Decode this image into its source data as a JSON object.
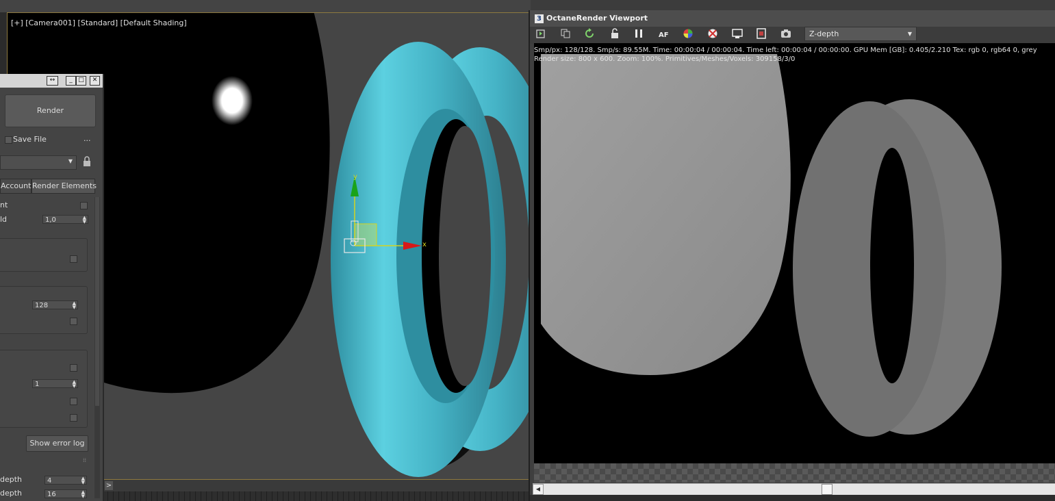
{
  "viewport": {
    "label": "[+] [Camera001] [Standard] [Default Shading]",
    "prompt": ">",
    "axis_y": "y",
    "axis_x": "x"
  },
  "render_panel": {
    "render_label": "Render",
    "save_file_label": "Save File",
    "more_label": "...",
    "tabs": [
      "Account",
      "Render Elements"
    ],
    "rows": [
      {
        "label": "nt"
      },
      {
        "label": "ld",
        "value": "1,0"
      },
      {
        "value": "128"
      },
      {
        "value": "1"
      },
      {
        "label": "depth",
        "value": "4"
      },
      {
        "label": "depth",
        "value": "16"
      }
    ],
    "error_log_label": "Show error log"
  },
  "octane": {
    "title": "OctaneRender Viewport",
    "icon_letter": "3",
    "render_type": "Z-depth",
    "stats_line1": "Smp/px: 128/128.   Smp/s: 89.55M.   Time: 00:00:04 / 00:00:04.   Time left: 00:00:04 / 00:00:00.   GPU Mem [GB]: 0.405/2.210   Tex: rgb 0, rgb64 0, grey",
    "stats_line2": "Render size: 800 x 600.   Zoom: 100%.   Primitives/Meshes/Voxels: 309158/3/0",
    "toolbar_icons": [
      "send-scene-icon",
      "copy-icon",
      "restart-icon",
      "lock-icon",
      "pause-icon",
      "autofocus-icon",
      "color-picker-icon",
      "clay-mode-icon",
      "region-icon",
      "film-region-icon",
      "camera-icon"
    ]
  },
  "colors": {
    "torus": "#4fc0d2",
    "gizmo_x": "#d81818",
    "gizmo_y": "#1aa31a",
    "selection_frame": "#8f7a3f"
  }
}
